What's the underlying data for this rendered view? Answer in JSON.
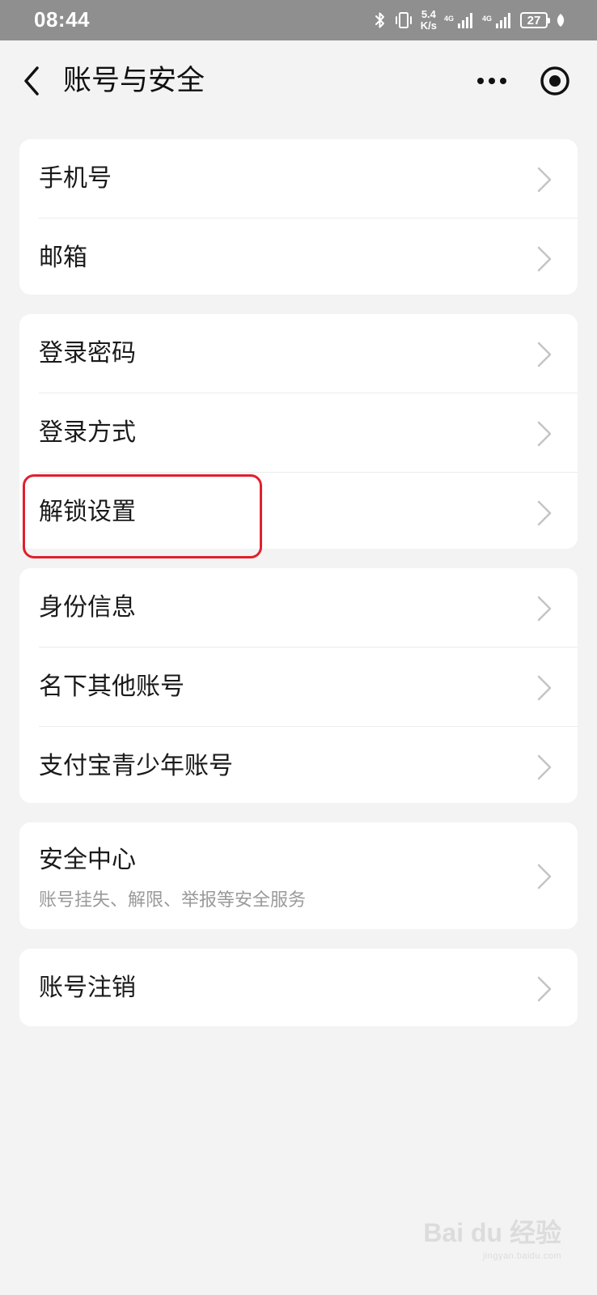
{
  "status_bar": {
    "time": "08:44",
    "net_speed_value": "5.4",
    "net_speed_unit": "K/s",
    "sim1_label": "4G",
    "sim2_label": "4G",
    "battery_level": "27",
    "icons": [
      "bluetooth-icon",
      "vibrate-icon",
      "signal-icon",
      "signal-icon",
      "battery-icon",
      "leaf-icon"
    ]
  },
  "nav": {
    "title": "账号与安全",
    "back_icon": "chevron-left-icon",
    "more_icon": "more-horizontal-icon",
    "target_icon": "target-icon"
  },
  "groups": [
    {
      "items": [
        {
          "label": "手机号"
        },
        {
          "label": "邮箱"
        }
      ]
    },
    {
      "items": [
        {
          "label": "登录密码"
        },
        {
          "label": "登录方式"
        },
        {
          "label": "解锁设置",
          "highlighted": true
        }
      ]
    },
    {
      "items": [
        {
          "label": "身份信息"
        },
        {
          "label": "名下其他账号"
        },
        {
          "label": "支付宝青少年账号"
        }
      ]
    },
    {
      "items": [
        {
          "label": "安全中心",
          "sub": "账号挂失、解限、举报等安全服务"
        }
      ]
    },
    {
      "items": [
        {
          "label": "账号注销"
        }
      ]
    }
  ],
  "watermark": {
    "brand": "Bai du 经验",
    "url": "jingyan.baidu.com"
  },
  "colors": {
    "page_bg": "#f3f3f3",
    "status_bar_bg": "#8f8f8f",
    "highlight_border": "#e0202e"
  }
}
